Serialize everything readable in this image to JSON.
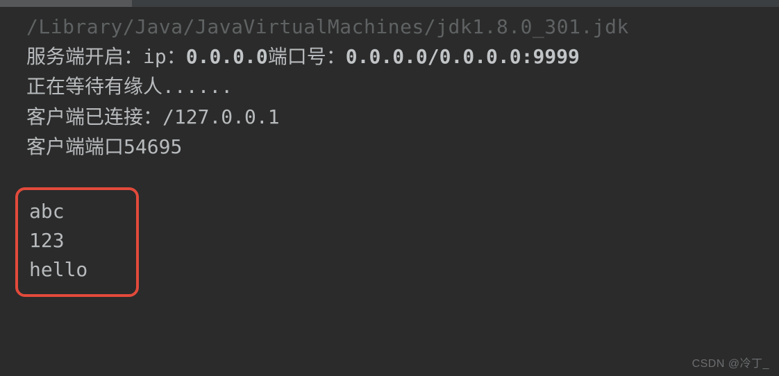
{
  "console": {
    "path": "/Library/Java/JavaVirtualMachines/jdk1.8.0_301.jdk",
    "line1_prefix": "服务端开启：",
    "line1_ip_label": "ip：",
    "line1_ip_value": "0.0.0.0",
    "line1_port_label": "端口号：",
    "line1_port_value": "0.0.0.0/0.0.0.0:9999",
    "line2": "正在等待有缘人......",
    "line3_label": "客户端已连接：",
    "line3_value": "/127.0.0.1",
    "line4_label": "客户端端口",
    "line4_value": "54695",
    "received": [
      "abc",
      "123",
      "hello"
    ]
  },
  "watermark": "CSDN @冷丁_"
}
